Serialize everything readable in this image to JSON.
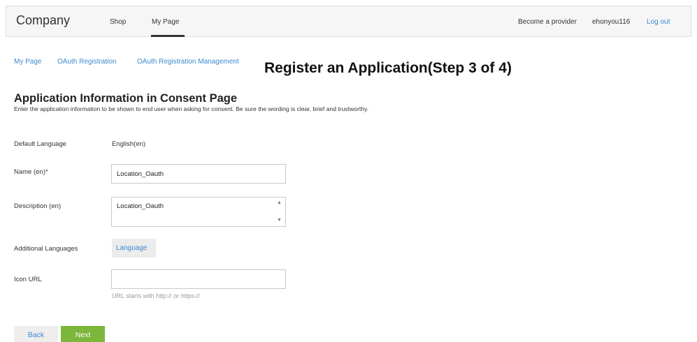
{
  "nav": {
    "brand": "Company",
    "shop": "Shop",
    "my_page": "My Page",
    "become_provider": "Become a provider",
    "username": "ehonyou116",
    "logout": "Log out"
  },
  "breadcrumb": [
    "My Page",
    "OAuth Registration",
    "OAuth Registration Management"
  ],
  "page_title": "Register an Application(Step 3 of 4)",
  "section": {
    "title": "Application Information in Consent Page",
    "description": "Enter the application information to be shown to end user when asking for consent. Be sure the wording is clear, brief and trustworthy."
  },
  "form": {
    "default_language_label": "Default Language",
    "default_language_value": "English(en)",
    "name_label": "Name (en)*",
    "name_value": "Location_Oauth",
    "description_label": "Description (en)",
    "description_value": "Location_Oauth",
    "additional_languages_label": "Additional Languages",
    "language_button": "Language",
    "icon_url_label": "Icon URL",
    "icon_url_value": "",
    "icon_url_hint": "URL starts with http:// or https://"
  },
  "buttons": {
    "back": "Back",
    "next": "Next"
  },
  "colors": {
    "link": "#3a8ad0",
    "next_button": "#7cb63a"
  }
}
